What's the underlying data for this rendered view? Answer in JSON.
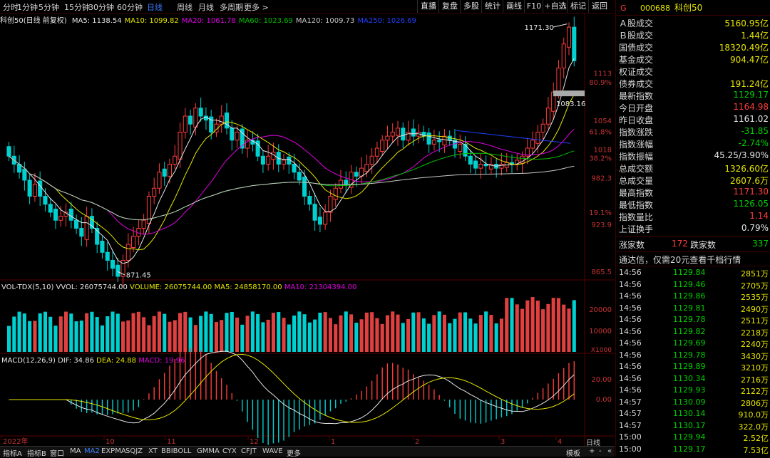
{
  "toolbar": {
    "periods": [
      "分时",
      "1分钟",
      "5分钟",
      "15分钟",
      "30分钟",
      "60分钟",
      "日线",
      "周线",
      "月线",
      "多周期",
      "更多 >"
    ],
    "active_period": "日线",
    "right_buttons": [
      "直播",
      "复盘",
      "多股",
      "统计",
      "画线",
      "F10",
      "+自选",
      "标记",
      "返回"
    ]
  },
  "main_chart": {
    "name": "科创50(日线 前复权)",
    "ma": [
      {
        "label": "MA5: 1138.54",
        "color": "#e6e6e6"
      },
      {
        "label": "MA10: 1099.82",
        "color": "#e6e600"
      },
      {
        "label": "MA20: 1061.78",
        "color": "#e000e0"
      },
      {
        "label": "MA60: 1023.69",
        "color": "#00c000"
      },
      {
        "label": "MA120: 1009.73",
        "color": "#c8c8c8"
      },
      {
        "label": "MA250: 1026.69",
        "color": "#2040ff"
      }
    ],
    "high_label": "1171.30",
    "low_label": "871.45",
    "mark_label": "1083.16",
    "axis_prices": [
      "1113",
      "1054",
      "1018",
      "982.3",
      "923.9",
      "865.5"
    ],
    "axis_pcts": [
      "80.9%",
      "61.8%",
      "38.2%",
      "19.1%"
    ]
  },
  "volume_chart": {
    "name": "VOL-TDX(5,10)",
    "vvol": "VVOL: 26075744.00",
    "volume": "VOLUME: 26075744.00",
    "ma5": "MA5: 24858170.00",
    "ma10": "MA10: 21304394.00",
    "axis": [
      "20000",
      "10000"
    ],
    "unit": "X1000"
  },
  "macd_chart": {
    "name": "MACD(12,26,9)",
    "dif": "DIF: 34.86",
    "dea": "DEA: 24.88",
    "macd": "MACD: 19.96",
    "axis": [
      "20.00",
      "0.00"
    ]
  },
  "x_axis": {
    "labels": [
      "2022年",
      "10",
      "11",
      "12",
      "1",
      "2",
      "3",
      "4"
    ]
  },
  "bottom_bar": {
    "tabs": [
      "指标A",
      "指标B",
      "窗口",
      "MA",
      "MA2",
      "EXPMA",
      "SQJZ",
      "XT",
      "BBIBOLL",
      "GMMA",
      "CYX",
      "CFJT",
      "WAVE",
      "更多"
    ],
    "active": "MA2",
    "right_tabs": [
      "日线",
      "模板",
      "+",
      "-",
      "«"
    ]
  },
  "quote_panel": {
    "flag": "G",
    "code": "000688",
    "name": "科创50",
    "rows": [
      {
        "label": "Ａ股成交",
        "value": "5160.95亿",
        "color": "y"
      },
      {
        "label": "Ｂ股成交",
        "value": "1.44亿",
        "color": "y"
      },
      {
        "label": "国债成交",
        "value": "18320.49亿",
        "color": "y"
      },
      {
        "label": "基金成交",
        "value": "904.47亿",
        "color": "y"
      },
      {
        "label": "权证成交",
        "value": "",
        "color": "y"
      },
      {
        "label": "债券成交",
        "value": "191.24亿",
        "color": "y"
      },
      {
        "label": "最新指数",
        "value": "1129.17",
        "color": "g"
      },
      {
        "label": "今日开盘",
        "value": "1164.98",
        "color": "r"
      },
      {
        "label": "昨日收盘",
        "value": "1161.02",
        "color": "w"
      },
      {
        "label": "指数涨跌",
        "value": "-31.85",
        "color": "g"
      },
      {
        "label": "指数涨幅",
        "value": "-2.74%",
        "color": "g"
      },
      {
        "label": "指数振幅",
        "value": "45.25/3.90%",
        "color": "w"
      },
      {
        "label": "总成交额",
        "value": "1326.60亿",
        "color": "y"
      },
      {
        "label": "总成交量",
        "value": "2607.6万",
        "color": "y"
      },
      {
        "label": "最高指数",
        "value": "1171.30",
        "color": "r"
      },
      {
        "label": "最低指数",
        "value": "1126.05",
        "color": "g"
      },
      {
        "label": "指数量比",
        "value": "1.14",
        "color": "r"
      },
      {
        "label": "上证换手",
        "value": "0.79%",
        "color": "w"
      }
    ],
    "breadth": {
      "up_label": "涨家数",
      "up": "172",
      "down_label": "跌家数",
      "down": "337"
    },
    "ad_text": "通达信，仅需20元查看千档行情",
    "ticks": [
      {
        "t": "14:56",
        "p": "1129.84",
        "v": "2851万"
      },
      {
        "t": "14:56",
        "p": "1129.46",
        "v": "2705万"
      },
      {
        "t": "14:56",
        "p": "1129.86",
        "v": "2535万"
      },
      {
        "t": "14:56",
        "p": "1129.81",
        "v": "2490万"
      },
      {
        "t": "14:56",
        "p": "1129.78",
        "v": "2511万"
      },
      {
        "t": "14:56",
        "p": "1129.82",
        "v": "2218万"
      },
      {
        "t": "14:56",
        "p": "1129.69",
        "v": "2240万"
      },
      {
        "t": "14:56",
        "p": "1129.78",
        "v": "3430万"
      },
      {
        "t": "14:56",
        "p": "1129.89",
        "v": "3210万"
      },
      {
        "t": "14:56",
        "p": "1130.34",
        "v": "2716万"
      },
      {
        "t": "14:56",
        "p": "1129.93",
        "v": "2122万"
      },
      {
        "t": "14:57",
        "p": "1130.09",
        "v": "2806万"
      },
      {
        "t": "14:57",
        "p": "1130.14",
        "v": "910.0万"
      },
      {
        "t": "14:57",
        "p": "1130.17",
        "v": "322.0万"
      },
      {
        "t": "15:00",
        "p": "1129.94",
        "v": "2.52亿"
      },
      {
        "t": "15:00",
        "p": "1129.17",
        "v": "7.53亿"
      }
    ]
  },
  "colors": {
    "up": "#ff3c3c",
    "down": "#00d0d0",
    "bg": "#000000"
  },
  "chart_data": {
    "type": "candlestick",
    "closes": [
      1010,
      1000,
      990,
      980,
      960,
      975,
      960,
      950,
      940,
      930,
      935,
      940,
      930,
      920,
      910,
      935,
      920,
      900,
      890,
      880,
      870,
      860,
      880,
      900,
      910,
      920,
      930,
      960,
      970,
      990,
      985,
      1000,
      1010,
      1040,
      1060,
      1050,
      1070,
      1060,
      1055,
      1040,
      1050,
      1060,
      1045,
      1030,
      1040,
      1020,
      1030,
      1025,
      1010,
      1000,
      1010,
      1015,
      1000,
      1005,
      1000,
      990,
      980,
      960,
      950,
      930,
      925,
      940,
      960,
      970,
      980,
      975,
      990,
      985,
      995,
      1000,
      1010,
      1020,
      1030,
      1035,
      1040,
      1045,
      1030,
      1040,
      1035,
      1040,
      1035,
      1025,
      1030,
      1028,
      1035,
      1030,
      1020,
      1025,
      1010,
      1000,
      995,
      1000,
      998,
      1000,
      995,
      1000,
      1002,
      1000,
      1005,
      1010,
      1020,
      1030,
      1040,
      1050,
      1070,
      1090,
      1120,
      1150,
      1171,
      1129
    ],
    "volume_axis": [
      "20000",
      "10000"
    ]
  }
}
